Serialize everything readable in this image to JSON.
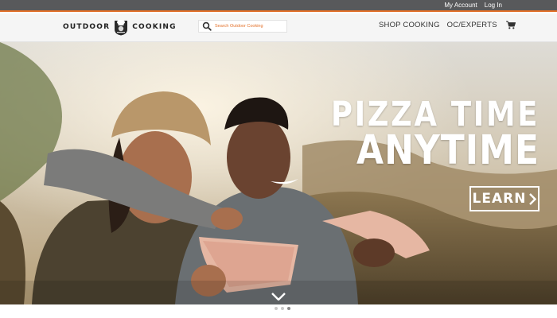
{
  "topbar": {
    "my_account": "My Account",
    "log_in": "Log In",
    "accent_color": "#e3712a",
    "bg_color": "#58595b"
  },
  "header": {
    "logo_left": "OUTDOOR",
    "logo_right": "COOKING",
    "logo_icon": "chef-badge-icon",
    "search_placeholder": "Search Outdoor Cooking",
    "search_icon": "search-icon",
    "nav": {
      "shop_cooking": "SHOP COOKING",
      "oc_experts_prefix": "OC/",
      "oc_experts_suffix": "EXPERTS"
    },
    "cart_icon": "cart-icon"
  },
  "hero": {
    "headline_line1": "PIZZA TIME",
    "headline_line2": "ANYTIME",
    "cta_label": "LEARN",
    "cta_icon": "chevron-right-icon",
    "scroll_icon": "chevron-down-icon",
    "image_description_icon": "hero-photo"
  },
  "carousel": {
    "slide_count": 3,
    "active_index": 2
  }
}
